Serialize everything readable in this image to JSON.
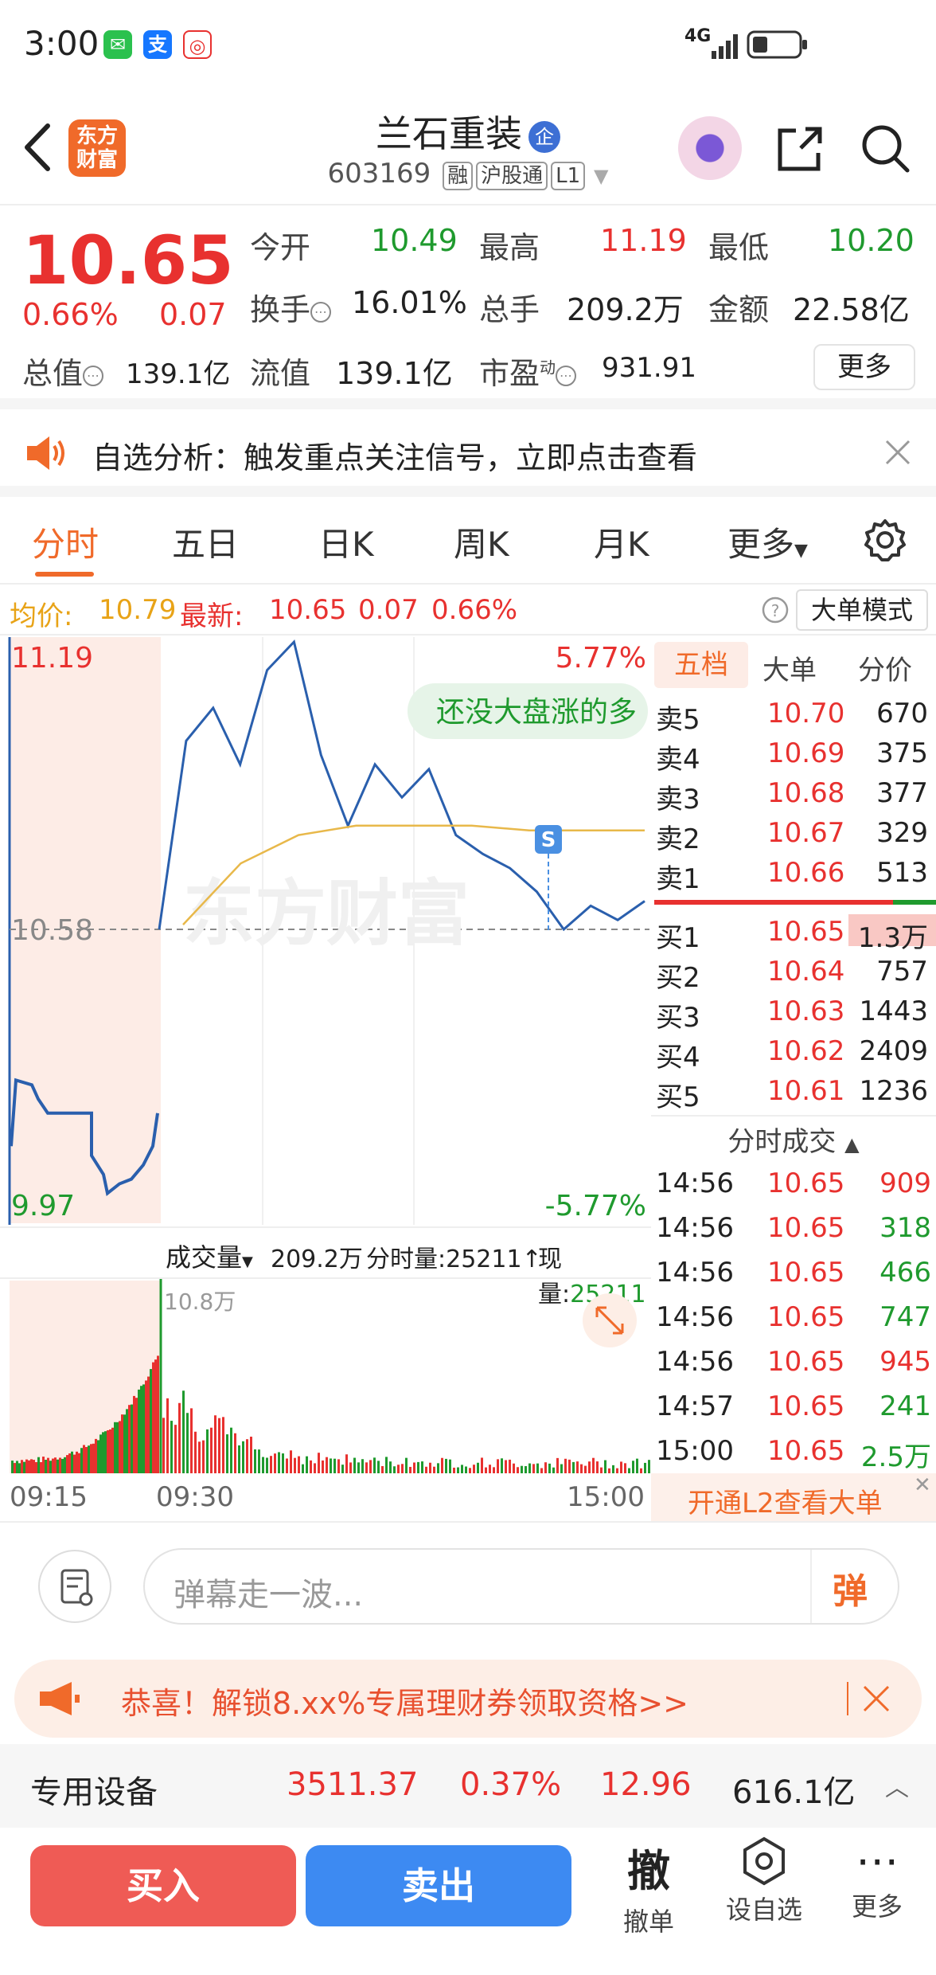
{
  "status": {
    "time": "3:00",
    "network": "4G"
  },
  "header": {
    "logo_text": "东方财富",
    "stock_name": "兰石重装",
    "name_tag": "企",
    "code": "603169",
    "tags": [
      "融",
      "沪股通",
      "L1"
    ]
  },
  "quote": {
    "price": "10.65",
    "pct": "0.66%",
    "change": "0.07",
    "fields": [
      {
        "label": "今开",
        "value": "10.49"
      },
      {
        "label": "最高",
        "value": "11.19"
      },
      {
        "label": "最低",
        "value": "10.20"
      },
      {
        "label": "换手",
        "value": "16.01%"
      },
      {
        "label": "总手",
        "value": "209.2万"
      },
      {
        "label": "金额",
        "value": "22.58亿"
      },
      {
        "label": "总值",
        "value": "139.1亿"
      },
      {
        "label": "流值",
        "value": "139.1亿"
      },
      {
        "label": "市盈",
        "value": "931.91"
      }
    ],
    "pe_sup": "动",
    "more_label": "更多"
  },
  "alert": {
    "text": "自选分析：触发重点关注信号，立即点击查看"
  },
  "tabs": [
    "分时",
    "五日",
    "日K",
    "周K",
    "月K",
    "更多"
  ],
  "infobar": {
    "avg_label": "均价:",
    "avg": "10.79",
    "latest_label": "最新:",
    "latest": "10.65",
    "chg": "0.07",
    "pct": "0.66%",
    "mode_btn": "大单模式"
  },
  "chart_data": {
    "type": "line",
    "ylim": [
      9.97,
      11.19
    ],
    "y_top_label": "11.19",
    "y_mid_label": "10.58",
    "y_bottom_label": "9.97",
    "pct_top": "5.77%",
    "pct_bottom": "-5.77%",
    "x_labels": [
      "09:15",
      "09:30",
      "15:00"
    ],
    "watermark": "东方财富",
    "bubble": "还没大盘涨的多",
    "volume_label": "成交量",
    "volume_total": "209.2万",
    "period_volume": "分时量:25211",
    "current_volume_label": "现量:",
    "current_volume": "25211",
    "volume_max": "10.8万",
    "price_series_approx": [
      10.58,
      10.98,
      11.05,
      10.93,
      11.13,
      11.19,
      10.95,
      10.8,
      10.93,
      10.86,
      10.92,
      10.78,
      10.74,
      10.71,
      10.66,
      10.58,
      10.63,
      10.6,
      10.64
    ],
    "avg_series_approx": [
      10.59,
      10.72,
      10.78,
      10.8,
      10.8,
      10.8,
      10.79,
      10.79,
      10.79
    ]
  },
  "orderbook": {
    "tabs": [
      "五档",
      "大单",
      "分价"
    ],
    "sells": [
      {
        "label": "卖5",
        "price": "10.70",
        "vol": "670"
      },
      {
        "label": "卖4",
        "price": "10.69",
        "vol": "375"
      },
      {
        "label": "卖3",
        "price": "10.68",
        "vol": "377"
      },
      {
        "label": "卖2",
        "price": "10.67",
        "vol": "329"
      },
      {
        "label": "卖1",
        "price": "10.66",
        "vol": "513"
      }
    ],
    "buys": [
      {
        "label": "买1",
        "price": "10.65",
        "vol": "1.3万"
      },
      {
        "label": "买2",
        "price": "10.64",
        "vol": "757"
      },
      {
        "label": "买3",
        "price": "10.63",
        "vol": "1443"
      },
      {
        "label": "买4",
        "price": "10.62",
        "vol": "2409"
      },
      {
        "label": "买5",
        "price": "10.61",
        "vol": "1236"
      }
    ],
    "ticks_title": "分时成交",
    "ticks": [
      {
        "time": "14:56",
        "price": "10.65",
        "vol": "909"
      },
      {
        "time": "14:56",
        "price": "10.65",
        "vol": "318"
      },
      {
        "time": "14:56",
        "price": "10.65",
        "vol": "466"
      },
      {
        "time": "14:56",
        "price": "10.65",
        "vol": "747"
      },
      {
        "time": "14:56",
        "price": "10.65",
        "vol": "945"
      },
      {
        "time": "14:57",
        "price": "10.65",
        "vol": "241"
      },
      {
        "time": "15:00",
        "price": "10.65",
        "vol": "2.5万"
      }
    ],
    "l2_label": "开通L2查看大单"
  },
  "comment": {
    "placeholder": "弹幕走一波...",
    "danmu": "弹"
  },
  "promo": {
    "text": "恭喜！解锁8.xx%专属理财券领取资格>>"
  },
  "sector": {
    "name": "专用设备",
    "index": "3511.37",
    "pct": "0.37%",
    "val3": "12.96",
    "amount": "616.1亿"
  },
  "bottom": {
    "buy": "买入",
    "sell": "卖出",
    "cancel_big": "撤",
    "cancel": "撤单",
    "watch": "设自选",
    "more": "更多"
  }
}
